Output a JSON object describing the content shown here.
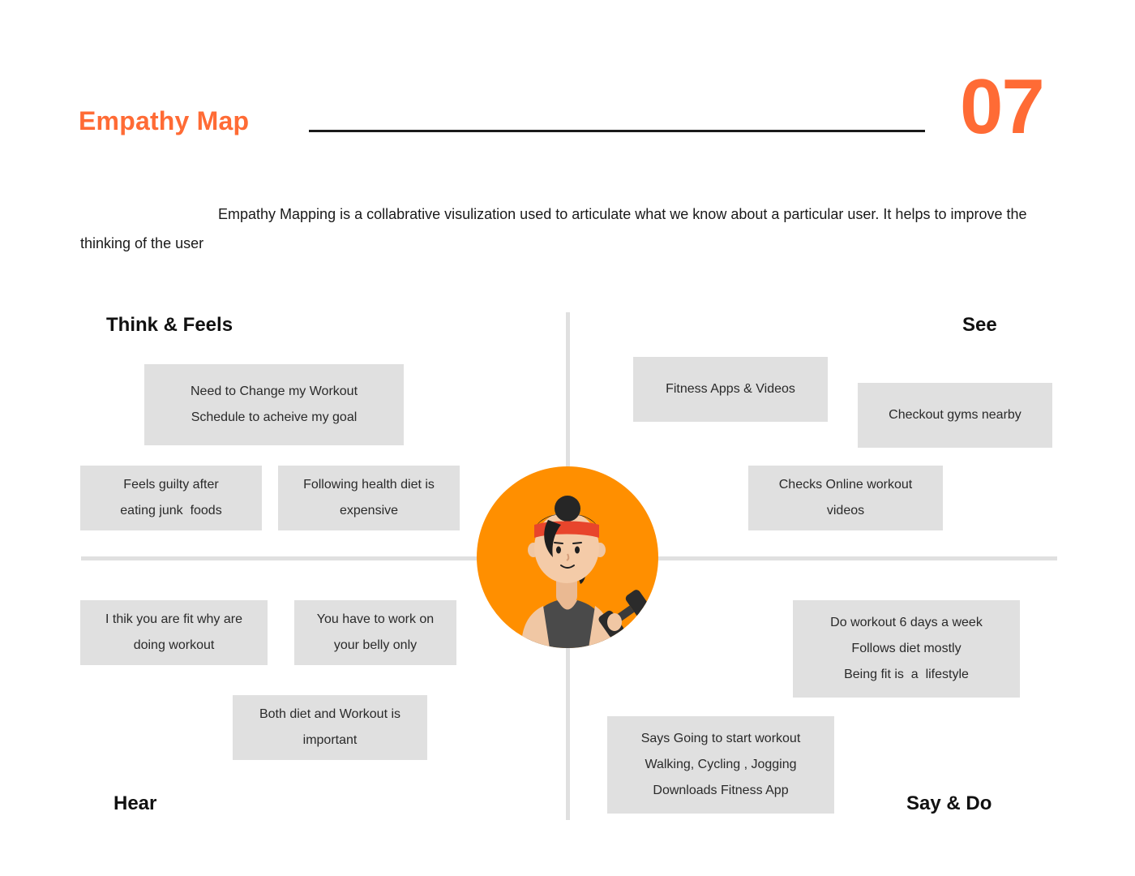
{
  "header": {
    "title": "Empathy Map",
    "page_number": "07",
    "accent_color": "#ff6b35"
  },
  "intro": {
    "text": "Empathy Mapping is a collabrative  visulization used to articulate what we know about a particular user. It helps to improve the thinking of the user"
  },
  "quadrants": {
    "think_feels": {
      "label": "Think & Feels",
      "notes": [
        {
          "lines": [
            "Need to Change my Workout",
            "Schedule to acheive my goal"
          ]
        },
        {
          "lines": [
            "Feels guilty after",
            "eating junk  foods"
          ]
        },
        {
          "lines": [
            "Following health diet is",
            "expensive"
          ]
        }
      ]
    },
    "see": {
      "label": "See",
      "notes": [
        {
          "lines": [
            "Fitness Apps & Videos"
          ]
        },
        {
          "lines": [
            "Checkout gyms nearby"
          ]
        },
        {
          "lines": [
            "Checks Online workout",
            "videos"
          ]
        }
      ]
    },
    "hear": {
      "label": "Hear",
      "notes": [
        {
          "lines": [
            "I thik you are fit why are",
            "doing workout"
          ]
        },
        {
          "lines": [
            "You have to work on",
            "your belly only"
          ]
        },
        {
          "lines": [
            "Both diet and Workout is",
            "important"
          ]
        }
      ]
    },
    "say_do": {
      "label": "Say & Do",
      "notes": [
        {
          "lines": [
            "Do workout 6 days a week",
            "Follows diet mostly",
            "Being fit is  a  lifestyle"
          ]
        },
        {
          "lines": [
            "Says Going to start workout",
            "Walking, Cycling , Jogging",
            "Downloads Fitness App"
          ]
        }
      ]
    }
  },
  "avatar": {
    "icon": "user-avatar-fitness-woman",
    "background_color": "#ff8f00"
  }
}
